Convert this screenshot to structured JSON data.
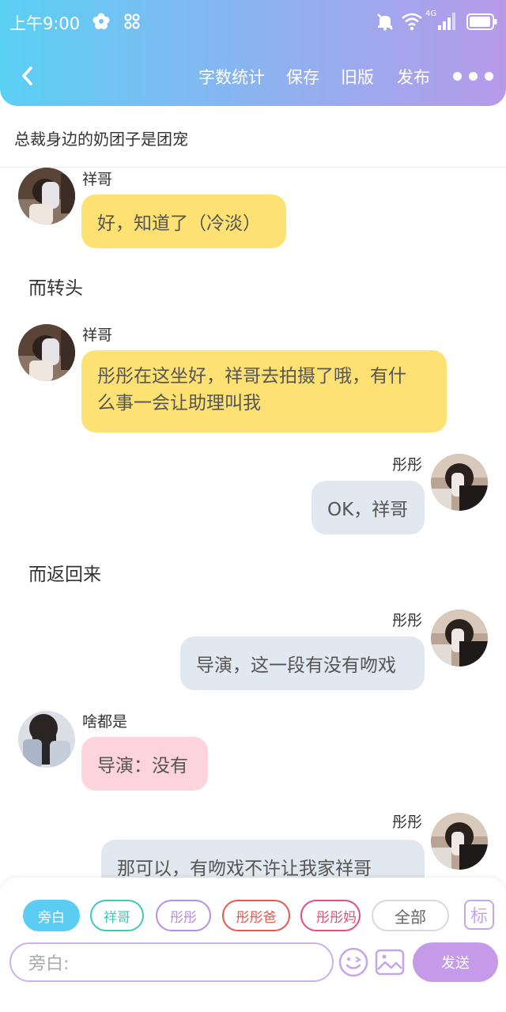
{
  "status": {
    "time": "上午9:00",
    "network": "4G"
  },
  "toolbar": {
    "word_count": "字数统计",
    "save": "保存",
    "old_version": "旧版",
    "publish": "发布"
  },
  "story_title": "总裁身边的奶团子是团宠",
  "messages": [
    {
      "type": "left",
      "name": "祥哥",
      "text": "好，知道了（冷淡）",
      "color": "#fde273"
    },
    {
      "type": "narration",
      "text": "而转头"
    },
    {
      "type": "left",
      "name": "祥哥",
      "text_line1": "彤彤在这坐好，祥哥去拍摄了哦，有什",
      "text_line2": "么事一会让助理叫我",
      "color": "#fde273"
    },
    {
      "type": "right",
      "name": "彤彤",
      "text": "OK，祥哥",
      "color": "#e2e8ef"
    },
    {
      "type": "narration",
      "text": "而返回来"
    },
    {
      "type": "right",
      "name": "彤彤",
      "text": "导演，这一段有没有吻戏",
      "color": "#e2e8ef"
    },
    {
      "type": "left",
      "name": "啥都是",
      "text": "导演：没有",
      "color": "#fdd3de"
    },
    {
      "type": "right",
      "name": "彤彤",
      "text": "那可以，有吻戏不许让我家祥哥",
      "color": "#e2e8ef"
    }
  ],
  "roles": [
    {
      "label": "旁白",
      "color": "#5ccdf2",
      "active": true
    },
    {
      "label": "祥哥",
      "color": "#3fc7b8",
      "active": false
    },
    {
      "label": "彤彤",
      "color": "#b58fe0",
      "active": false
    },
    {
      "label": "彤彤爸",
      "color": "#e5584f",
      "active": false
    },
    {
      "label": "彤彤妈",
      "color": "#e0507a",
      "active": false
    },
    {
      "label": "全部",
      "color": "#cccccc",
      "active": false
    }
  ],
  "tag_button": "标",
  "input": {
    "placeholder": "旁白:"
  },
  "send": "发送",
  "colors": {
    "header_gradient_start": "#5ad0f3",
    "header_gradient_end": "#b79ae9",
    "send_button": "#c59be9"
  }
}
